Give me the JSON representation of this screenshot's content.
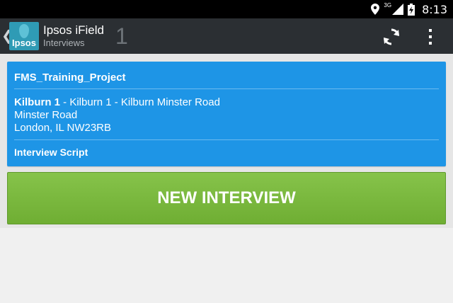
{
  "status_bar": {
    "network_label": "3G",
    "time": "8:13"
  },
  "action_bar": {
    "logo_text": "Ipsos",
    "title": "Ipsos iField",
    "subtitle": "Interviews",
    "count": "1",
    "icons": [
      "back-chevron-icon",
      "sync-icon",
      "overflow-menu-icon"
    ]
  },
  "project_card": {
    "project_name": "FMS_Training_Project",
    "location_name": "Kilburn 1",
    "location_rest": " - Kilburn 1 - Kilburn Minster Road",
    "address_line_2": "Minster Road",
    "address_line_3": "London, IL NW23RB",
    "script_label": "Interview Script",
    "color": "#1e95e6"
  },
  "new_interview_button": {
    "label": "NEW INTERVIEW",
    "color": "#7cbb40"
  }
}
